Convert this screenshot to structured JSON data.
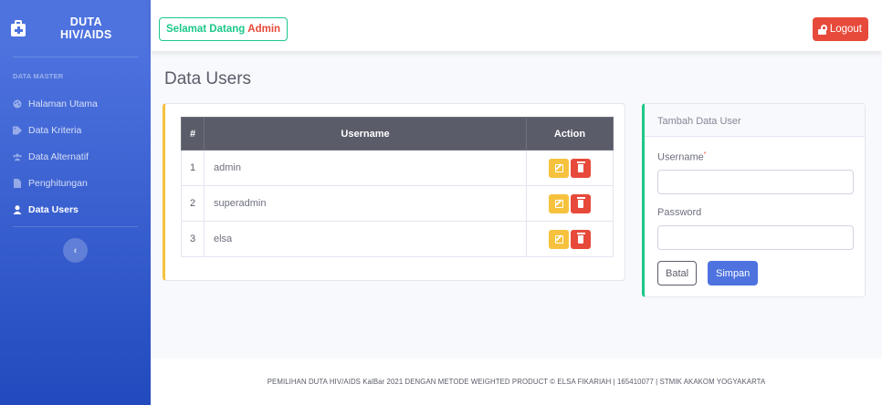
{
  "sidebar": {
    "brand_line1": "DUTA",
    "brand_line2": "HIV/AIDS",
    "heading": "DATA MASTER",
    "items": [
      {
        "label": "Halaman Utama",
        "icon": "palette-icon"
      },
      {
        "label": "Data Kriteria",
        "icon": "tag-icon"
      },
      {
        "label": "Data Alternatif",
        "icon": "users-icon"
      },
      {
        "label": "Penghitungan",
        "icon": "file-icon"
      },
      {
        "label": "Data Users",
        "icon": "user-icon",
        "active": true
      }
    ],
    "toggle": "‹"
  },
  "topbar": {
    "welcome_prefix": "Selamat Datang",
    "welcome_name": "Admin",
    "logout_label": "Logout"
  },
  "main": {
    "page_title": "Data Users",
    "table": {
      "headers": [
        "#",
        "Username",
        "Action"
      ],
      "rows": [
        {
          "num": "1",
          "username": "admin"
        },
        {
          "num": "2",
          "username": "superadmin"
        },
        {
          "num": "3",
          "username": "elsa"
        }
      ]
    },
    "form": {
      "title": "Tambah Data User",
      "username_label": "Username",
      "required_mark": "*",
      "username_value": "",
      "password_label": "Password",
      "password_value": "",
      "cancel_label": "Batal",
      "save_label": "Simpan"
    }
  },
  "footer": {
    "text": "PEMILIHAN DUTA HIV/AIDS KalBar 2021 DENGAN METODE WEIGHTED PRODUCT © ELSA FIKARIAH | 165410077 | STMIK AKAKOM YOGYAKARTA"
  },
  "colors": {
    "primary": "#4e73df",
    "success": "#1cc88a",
    "warning": "#f6c23e",
    "danger": "#e74a3b",
    "dark": "#5a5c69"
  }
}
